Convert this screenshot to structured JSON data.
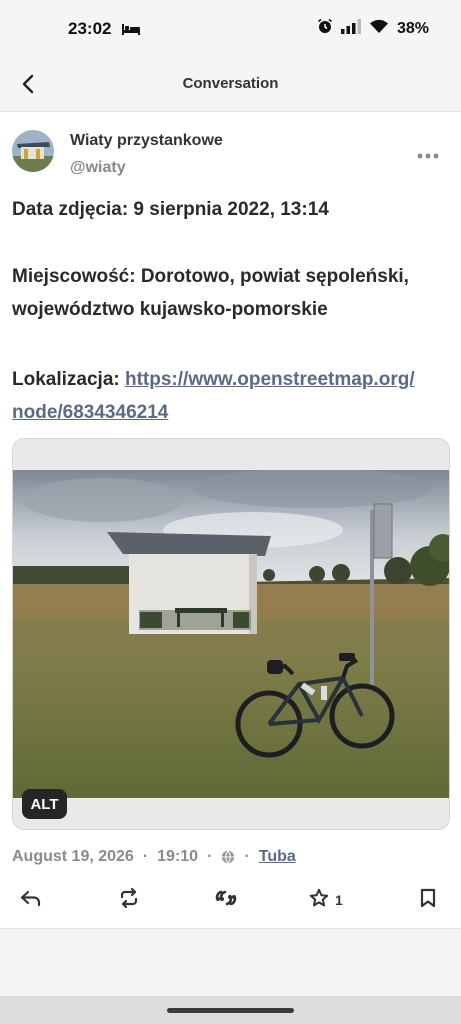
{
  "status_bar": {
    "time": "23:02",
    "battery": "38%"
  },
  "app_bar": {
    "title": "Conversation"
  },
  "post": {
    "display_name": "Wiaty przystankowe",
    "handle": "@wiaty",
    "line_date": "Data zdjęcia: 9 sierpnia 2022, 13:14",
    "line_place_1": "Miejscowość: Dorotowo, powiat sępoleński,",
    "line_place_2": "województwo kujawsko-pomorskie",
    "line_loc_label": "Lokalizacja: ",
    "line_loc_link_1": "https://www.openstreetmap.org/",
    "line_loc_link_2": "node/6834346214",
    "alt_badge": "ALT",
    "date": "August 19, 2026",
    "time": "19:10",
    "server": "Tuba",
    "favourites_count": "1",
    "separator": "·"
  },
  "icons": {
    "back": "back-arrow-icon",
    "more": "more-dots-icon",
    "reply": "reply-icon",
    "boost": "boost-icon",
    "quote": "quote-icon",
    "favourite": "star-icon",
    "bookmark": "bookmark-icon",
    "globe": "globe-icon"
  },
  "colors": {
    "link": "#5d6a86",
    "bar_bg": "#f5f5f4",
    "muted": "#8a8a8a"
  }
}
